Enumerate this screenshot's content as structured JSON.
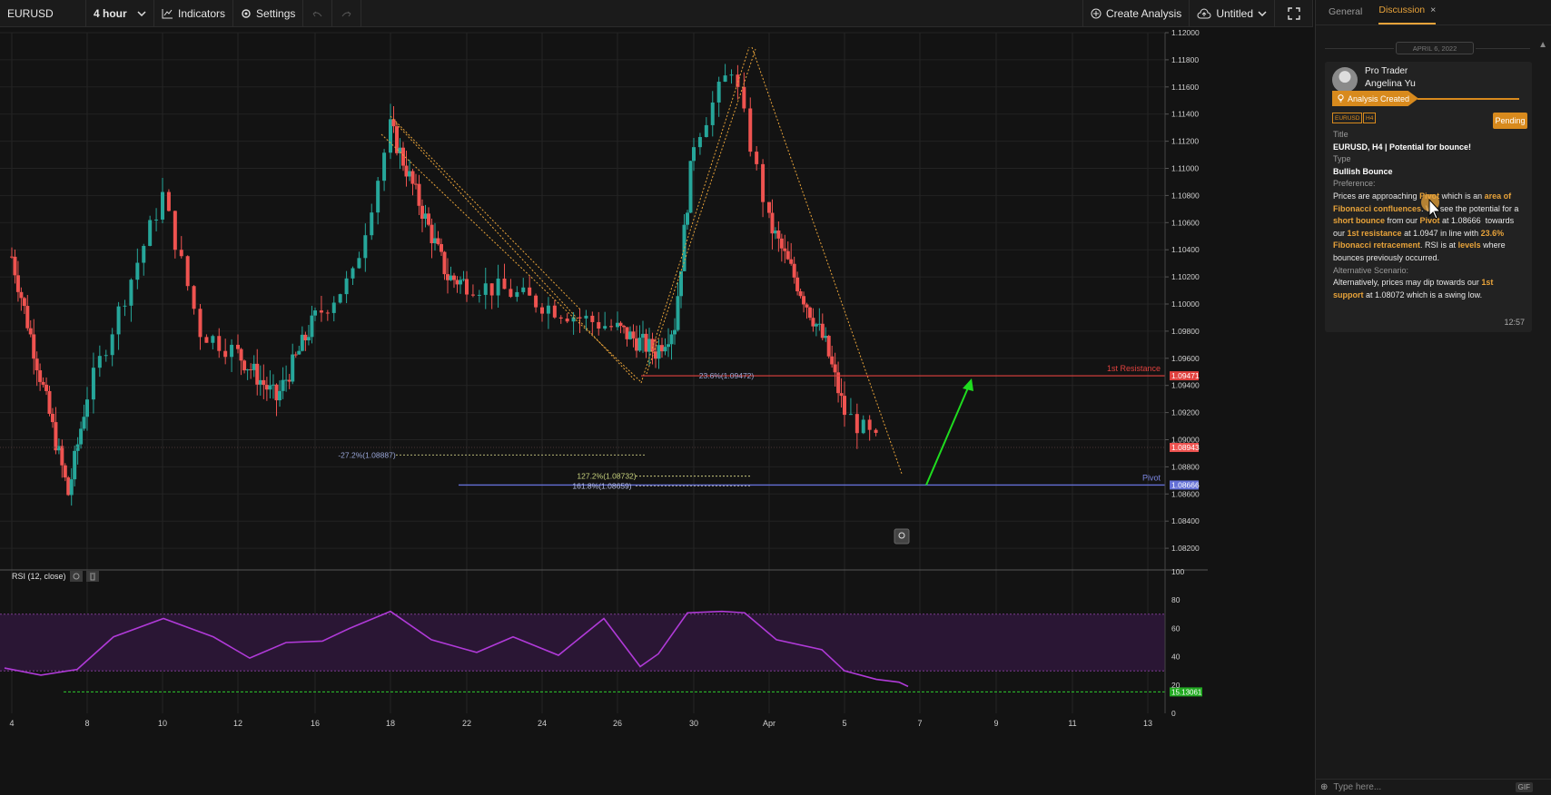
{
  "toolbar": {
    "symbol": "EURUSD",
    "interval": "4 hour",
    "indicators_label": "Indicators",
    "settings_label": "Settings",
    "create_analysis_label": "Create Analysis",
    "layout_name": "Untitled"
  },
  "chart": {
    "price_ticks": [
      "1.12000",
      "1.11800",
      "1.11600",
      "1.11400",
      "1.11200",
      "1.11000",
      "1.10800",
      "1.10600",
      "1.10400",
      "1.10200",
      "1.10000",
      "1.09800",
      "1.09600",
      "1.09400",
      "1.09200",
      "1.09000",
      "1.08800",
      "1.08600",
      "1.08400",
      "1.08200"
    ],
    "date_ticks": [
      "4",
      "8",
      "10",
      "12",
      "16",
      "18",
      "22",
      "24",
      "26",
      "30",
      "Apr",
      "5",
      "7",
      "9",
      "11",
      "13"
    ],
    "rsi_ticks": [
      "100",
      "80",
      "60",
      "40",
      "20",
      "0"
    ],
    "indicator_label": "RSI (12, close)",
    "resistance_label": "1st Resistance",
    "resistance_price": "1.09471",
    "pivot_label": "Pivot",
    "pivot_price": "1.08666",
    "last_price": "1.08943",
    "fib_23": "23.6%(1.09472)",
    "fib_neg27": "-27.2%(1.08887)",
    "fib_127": "127.2%(1.08732)",
    "fib_161": "161.8%(1.08659)",
    "rsi_value": "15.13061",
    "colors": {
      "up": "#26a69a",
      "down": "#ef5350",
      "resistance": "#e0413e",
      "pivot": "#6470d6",
      "fib": "#e8a33a",
      "rsi": "#b03ad8",
      "arrow": "#1fdc1f"
    }
  },
  "chart_data": {
    "type": "candlestick",
    "symbol": "EURUSD",
    "interval": "4 hour",
    "ylim": [
      1.081,
      1.121
    ],
    "approx_close_path": [
      {
        "date": "Mar 4",
        "close": 1.1035
      },
      {
        "date": "Mar 7",
        "close": 1.086
      },
      {
        "date": "Mar 10",
        "close": 1.108
      },
      {
        "date": "Mar 11",
        "close": 1.098
      },
      {
        "date": "Mar 14",
        "close": 1.093
      },
      {
        "date": "Mar 17",
        "close": 1.102
      },
      {
        "date": "Mar 18",
        "close": 1.113
      },
      {
        "date": "Mar 21",
        "close": 1.102
      },
      {
        "date": "Mar 23",
        "close": 1.101
      },
      {
        "date": "Mar 25",
        "close": 1.099
      },
      {
        "date": "Mar 28",
        "close": 1.0965
      },
      {
        "date": "Mar 29",
        "close": 1.0985
      },
      {
        "date": "Mar 30",
        "close": 1.112
      },
      {
        "date": "Mar 31",
        "close": 1.1175
      },
      {
        "date": "Apr 1",
        "close": 1.106
      },
      {
        "date": "Apr 4",
        "close": 1.097
      },
      {
        "date": "Apr 5",
        "close": 1.092
      },
      {
        "date": "Apr 6",
        "close": 1.0894
      }
    ],
    "horizontal_levels": [
      {
        "name": "1st Resistance",
        "value": 1.09471
      },
      {
        "name": "Pivot",
        "value": 1.08666
      }
    ],
    "rsi": {
      "period": 12,
      "last": 15.13061,
      "ylim": [
        0,
        100
      ],
      "bands": [
        30,
        70
      ]
    }
  },
  "panel": {
    "tab_general": "General",
    "tab_discussion": "Discussion",
    "close_glyph": "×",
    "date": "APRIL 6, 2022",
    "role": "Pro Trader",
    "user": "Angelina Yu",
    "status": "Analysis Created",
    "tag_symbol": "EURUSD",
    "tag_interval": "H4",
    "pending_label": "Pending",
    "title_label": "Title",
    "title": "EURUSD, H4 | Potential for bounce!",
    "type_label": "Type",
    "type": "Bullish Bounce",
    "preference_label": "Preference:",
    "alt_label": "Alternative Scenario:",
    "time": "12:57",
    "message_placeholder": "Type here...",
    "gif_label": "GIF"
  }
}
